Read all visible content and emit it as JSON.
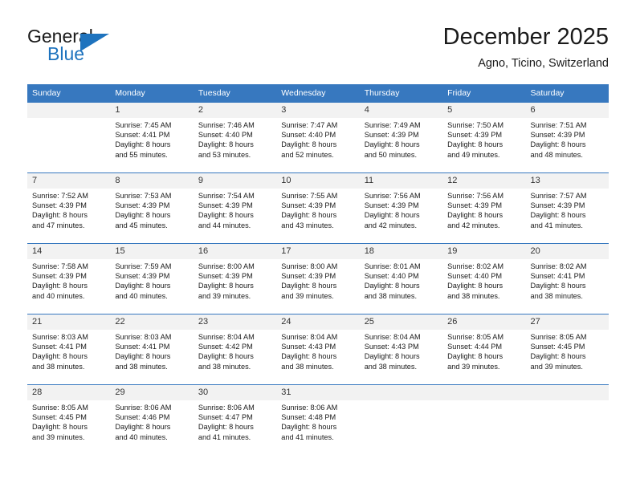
{
  "brand": {
    "name_part1": "General",
    "name_part2": "Blue",
    "logo_icon": "triangle-logo-icon"
  },
  "header": {
    "month_title": "December 2025",
    "location": "Agno, Ticino, Switzerland"
  },
  "colors": {
    "header_blue": "#3778bf",
    "brand_blue": "#1e73be",
    "daynum_bg": "#f2f2f2",
    "text": "#1a1a1a"
  },
  "calendar": {
    "weekday_headers": [
      "Sunday",
      "Monday",
      "Tuesday",
      "Wednesday",
      "Thursday",
      "Friday",
      "Saturday"
    ],
    "weeks": [
      [
        {
          "day": "",
          "sunrise": "",
          "sunset": "",
          "daylight1": "",
          "daylight2": ""
        },
        {
          "day": "1",
          "sunrise": "Sunrise: 7:45 AM",
          "sunset": "Sunset: 4:41 PM",
          "daylight1": "Daylight: 8 hours",
          "daylight2": "and 55 minutes."
        },
        {
          "day": "2",
          "sunrise": "Sunrise: 7:46 AM",
          "sunset": "Sunset: 4:40 PM",
          "daylight1": "Daylight: 8 hours",
          "daylight2": "and 53 minutes."
        },
        {
          "day": "3",
          "sunrise": "Sunrise: 7:47 AM",
          "sunset": "Sunset: 4:40 PM",
          "daylight1": "Daylight: 8 hours",
          "daylight2": "and 52 minutes."
        },
        {
          "day": "4",
          "sunrise": "Sunrise: 7:49 AM",
          "sunset": "Sunset: 4:39 PM",
          "daylight1": "Daylight: 8 hours",
          "daylight2": "and 50 minutes."
        },
        {
          "day": "5",
          "sunrise": "Sunrise: 7:50 AM",
          "sunset": "Sunset: 4:39 PM",
          "daylight1": "Daylight: 8 hours",
          "daylight2": "and 49 minutes."
        },
        {
          "day": "6",
          "sunrise": "Sunrise: 7:51 AM",
          "sunset": "Sunset: 4:39 PM",
          "daylight1": "Daylight: 8 hours",
          "daylight2": "and 48 minutes."
        }
      ],
      [
        {
          "day": "7",
          "sunrise": "Sunrise: 7:52 AM",
          "sunset": "Sunset: 4:39 PM",
          "daylight1": "Daylight: 8 hours",
          "daylight2": "and 47 minutes."
        },
        {
          "day": "8",
          "sunrise": "Sunrise: 7:53 AM",
          "sunset": "Sunset: 4:39 PM",
          "daylight1": "Daylight: 8 hours",
          "daylight2": "and 45 minutes."
        },
        {
          "day": "9",
          "sunrise": "Sunrise: 7:54 AM",
          "sunset": "Sunset: 4:39 PM",
          "daylight1": "Daylight: 8 hours",
          "daylight2": "and 44 minutes."
        },
        {
          "day": "10",
          "sunrise": "Sunrise: 7:55 AM",
          "sunset": "Sunset: 4:39 PM",
          "daylight1": "Daylight: 8 hours",
          "daylight2": "and 43 minutes."
        },
        {
          "day": "11",
          "sunrise": "Sunrise: 7:56 AM",
          "sunset": "Sunset: 4:39 PM",
          "daylight1": "Daylight: 8 hours",
          "daylight2": "and 42 minutes."
        },
        {
          "day": "12",
          "sunrise": "Sunrise: 7:56 AM",
          "sunset": "Sunset: 4:39 PM",
          "daylight1": "Daylight: 8 hours",
          "daylight2": "and 42 minutes."
        },
        {
          "day": "13",
          "sunrise": "Sunrise: 7:57 AM",
          "sunset": "Sunset: 4:39 PM",
          "daylight1": "Daylight: 8 hours",
          "daylight2": "and 41 minutes."
        }
      ],
      [
        {
          "day": "14",
          "sunrise": "Sunrise: 7:58 AM",
          "sunset": "Sunset: 4:39 PM",
          "daylight1": "Daylight: 8 hours",
          "daylight2": "and 40 minutes."
        },
        {
          "day": "15",
          "sunrise": "Sunrise: 7:59 AM",
          "sunset": "Sunset: 4:39 PM",
          "daylight1": "Daylight: 8 hours",
          "daylight2": "and 40 minutes."
        },
        {
          "day": "16",
          "sunrise": "Sunrise: 8:00 AM",
          "sunset": "Sunset: 4:39 PM",
          "daylight1": "Daylight: 8 hours",
          "daylight2": "and 39 minutes."
        },
        {
          "day": "17",
          "sunrise": "Sunrise: 8:00 AM",
          "sunset": "Sunset: 4:39 PM",
          "daylight1": "Daylight: 8 hours",
          "daylight2": "and 39 minutes."
        },
        {
          "day": "18",
          "sunrise": "Sunrise: 8:01 AM",
          "sunset": "Sunset: 4:40 PM",
          "daylight1": "Daylight: 8 hours",
          "daylight2": "and 38 minutes."
        },
        {
          "day": "19",
          "sunrise": "Sunrise: 8:02 AM",
          "sunset": "Sunset: 4:40 PM",
          "daylight1": "Daylight: 8 hours",
          "daylight2": "and 38 minutes."
        },
        {
          "day": "20",
          "sunrise": "Sunrise: 8:02 AM",
          "sunset": "Sunset: 4:41 PM",
          "daylight1": "Daylight: 8 hours",
          "daylight2": "and 38 minutes."
        }
      ],
      [
        {
          "day": "21",
          "sunrise": "Sunrise: 8:03 AM",
          "sunset": "Sunset: 4:41 PM",
          "daylight1": "Daylight: 8 hours",
          "daylight2": "and 38 minutes."
        },
        {
          "day": "22",
          "sunrise": "Sunrise: 8:03 AM",
          "sunset": "Sunset: 4:41 PM",
          "daylight1": "Daylight: 8 hours",
          "daylight2": "and 38 minutes."
        },
        {
          "day": "23",
          "sunrise": "Sunrise: 8:04 AM",
          "sunset": "Sunset: 4:42 PM",
          "daylight1": "Daylight: 8 hours",
          "daylight2": "and 38 minutes."
        },
        {
          "day": "24",
          "sunrise": "Sunrise: 8:04 AM",
          "sunset": "Sunset: 4:43 PM",
          "daylight1": "Daylight: 8 hours",
          "daylight2": "and 38 minutes."
        },
        {
          "day": "25",
          "sunrise": "Sunrise: 8:04 AM",
          "sunset": "Sunset: 4:43 PM",
          "daylight1": "Daylight: 8 hours",
          "daylight2": "and 38 minutes."
        },
        {
          "day": "26",
          "sunrise": "Sunrise: 8:05 AM",
          "sunset": "Sunset: 4:44 PM",
          "daylight1": "Daylight: 8 hours",
          "daylight2": "and 39 minutes."
        },
        {
          "day": "27",
          "sunrise": "Sunrise: 8:05 AM",
          "sunset": "Sunset: 4:45 PM",
          "daylight1": "Daylight: 8 hours",
          "daylight2": "and 39 minutes."
        }
      ],
      [
        {
          "day": "28",
          "sunrise": "Sunrise: 8:05 AM",
          "sunset": "Sunset: 4:45 PM",
          "daylight1": "Daylight: 8 hours",
          "daylight2": "and 39 minutes."
        },
        {
          "day": "29",
          "sunrise": "Sunrise: 8:06 AM",
          "sunset": "Sunset: 4:46 PM",
          "daylight1": "Daylight: 8 hours",
          "daylight2": "and 40 minutes."
        },
        {
          "day": "30",
          "sunrise": "Sunrise: 8:06 AM",
          "sunset": "Sunset: 4:47 PM",
          "daylight1": "Daylight: 8 hours",
          "daylight2": "and 41 minutes."
        },
        {
          "day": "31",
          "sunrise": "Sunrise: 8:06 AM",
          "sunset": "Sunset: 4:48 PM",
          "daylight1": "Daylight: 8 hours",
          "daylight2": "and 41 minutes."
        },
        {
          "day": "",
          "sunrise": "",
          "sunset": "",
          "daylight1": "",
          "daylight2": ""
        },
        {
          "day": "",
          "sunrise": "",
          "sunset": "",
          "daylight1": "",
          "daylight2": ""
        },
        {
          "day": "",
          "sunrise": "",
          "sunset": "",
          "daylight1": "",
          "daylight2": ""
        }
      ]
    ]
  }
}
